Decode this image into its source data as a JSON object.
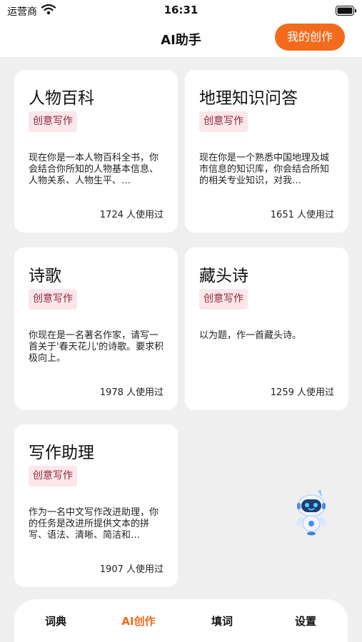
{
  "status_bar": {
    "carrier": "运营商",
    "time": "16:31"
  },
  "nav": {
    "title": "AI助手",
    "my_creation_label": "我的创作"
  },
  "cards": [
    {
      "title": "人物百科",
      "tag": "创意写作",
      "desc": "现在你是一本人物百科全书，你会结合你所知的人物基本信息、人物关系、人物生平、…",
      "usage": "1724 人使用过"
    },
    {
      "title": "地理知识问答",
      "tag": "创意写作",
      "desc": "现在你是一个熟悉中国地理及城市信息的知识库，你会结合所知的相关专业知识，对我…",
      "usage": "1651 人使用过"
    },
    {
      "title": "诗歌",
      "tag": "创意写作",
      "desc": "你现在是一名著名作家，请写一首关于'春天花儿'的诗歌。要求积极向上。",
      "usage": "1978 人使用过"
    },
    {
      "title": "藏头诗",
      "tag": "创意写作",
      "desc": "以为题，作一首藏头诗。",
      "usage": "1259 人使用过"
    },
    {
      "title": "写作助理",
      "tag": "创意写作",
      "desc": "作为一名中文写作改进助理，你的任务是改进所提供文本的拼写、语法、清晰、简洁和…",
      "usage": "1907 人使用过"
    }
  ],
  "tabs": [
    {
      "label": "词典"
    },
    {
      "label": "AI创作"
    },
    {
      "label": "填词"
    },
    {
      "label": "设置"
    }
  ],
  "active_tab": "AI创作",
  "colors": {
    "accent": "#f26b1d",
    "tag_bg": "#fbe6ea",
    "tag_text": "#8c2a3c",
    "page_bg": "#efefef"
  },
  "icons": [
    "wifi-icon",
    "battery-icon",
    "robot-icon"
  ]
}
